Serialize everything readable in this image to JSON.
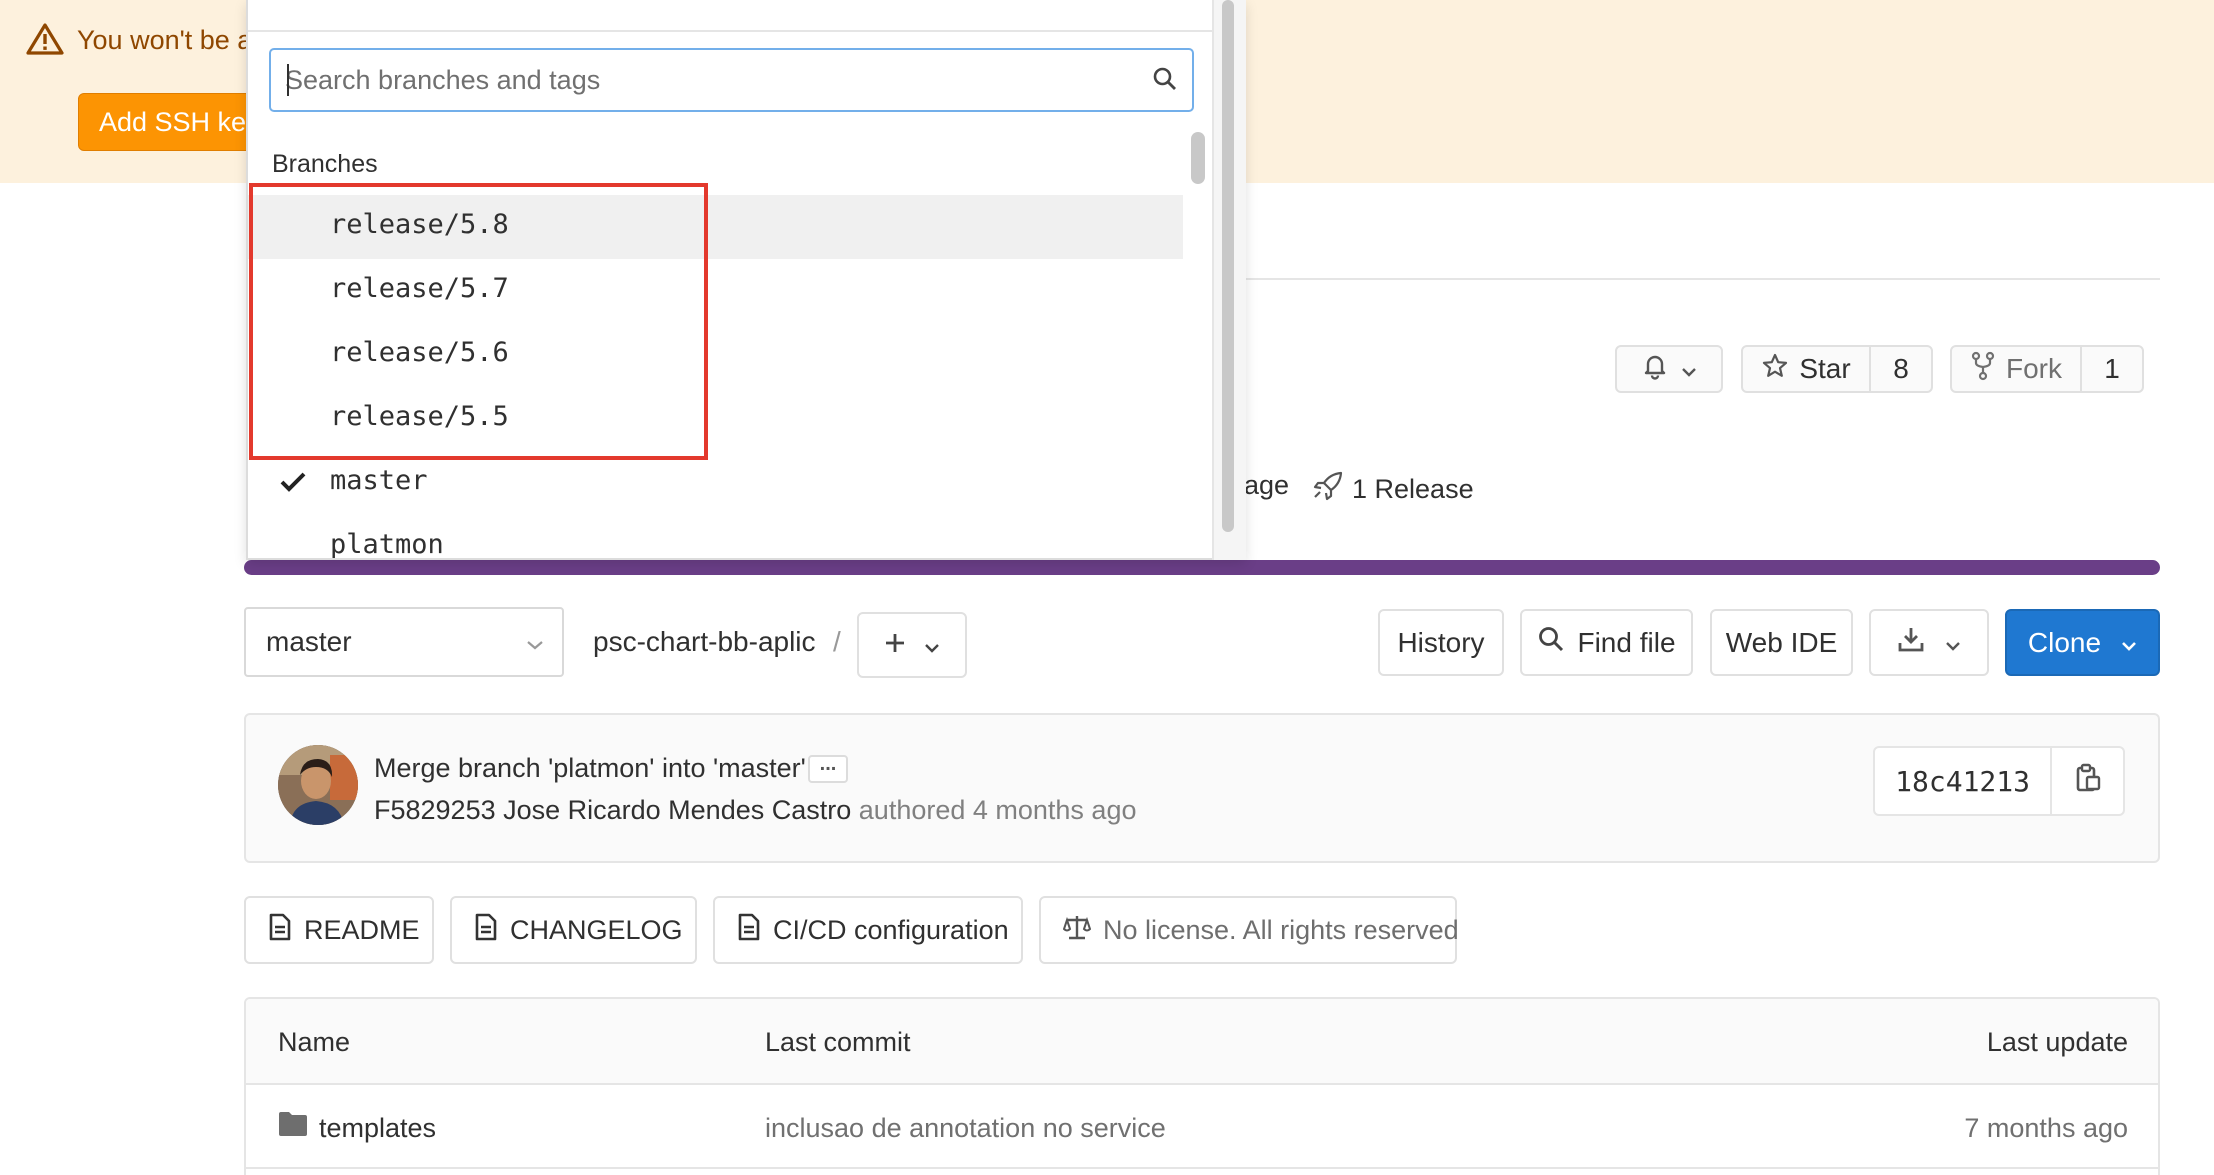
{
  "banner": {
    "text": "You won't be a",
    "ssh_button": "Add SSH key",
    "color": "#fdf1dd",
    "text_color": "#8f4700",
    "button_color": "#fc9403"
  },
  "project": {
    "star_label": "Star",
    "star_count": "8",
    "fork_label": "Fork",
    "fork_count": "1",
    "stat_partial": "age",
    "releases": "1 Release"
  },
  "toolbar": {
    "ref": "master",
    "breadcrumb": "psc-chart-bb-aplic",
    "breadcrumb_sep": "/",
    "history": "History",
    "find_file": "Find file",
    "web_ide": "Web IDE",
    "clone": "Clone",
    "accent": "#1f78d1"
  },
  "commit": {
    "title": "Merge branch 'platmon' into 'master'",
    "ellipsis": "...",
    "author": "F5829253 Jose Ricardo Mendes Castro",
    "authored_text": "authored 4 months ago",
    "sha": "18c41213"
  },
  "shortcuts": {
    "readme": "README",
    "changelog": "CHANGELOG",
    "cicd": "CI/CD configuration",
    "license": "No license. All rights reserved"
  },
  "table": {
    "headers": {
      "name": "Name",
      "last_commit": "Last commit",
      "last_update": "Last update"
    },
    "rows": [
      {
        "name": "templates",
        "commit": "inclusao de annotation no service",
        "updated": "7 months ago"
      }
    ]
  },
  "dropdown": {
    "search_placeholder": "Search branches and tags",
    "section": "Branches",
    "items": [
      {
        "label": "release/5.8",
        "selected": false
      },
      {
        "label": "release/5.7",
        "selected": false
      },
      {
        "label": "release/5.6",
        "selected": false
      },
      {
        "label": "release/5.5",
        "selected": false
      },
      {
        "label": "master",
        "selected": true
      },
      {
        "label": "platmon",
        "selected": false
      }
    ],
    "annotation_color": "#e3392d"
  }
}
